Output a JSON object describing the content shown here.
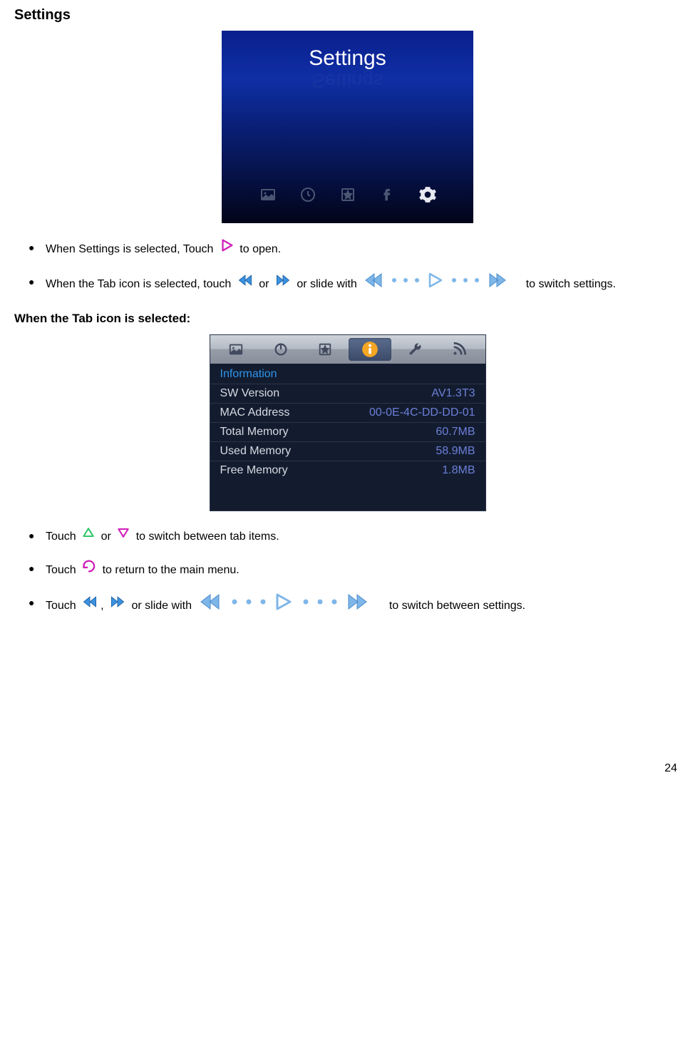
{
  "heading": "Settings",
  "settings_screen": {
    "title": "Settings",
    "icons": [
      {
        "name": "picture-icon",
        "active": false
      },
      {
        "name": "clock-icon",
        "active": false
      },
      {
        "name": "star-icon",
        "active": false
      },
      {
        "name": "facebook-icon",
        "active": false
      },
      {
        "name": "gear-icon",
        "active": true
      }
    ]
  },
  "bullets_top": [
    {
      "pre": "When Settings is selected, Touch ",
      "post": " to open."
    },
    {
      "pre": "When the Tab icon is selected, touch ",
      "mid1": " or ",
      "mid2": " or slide with  ",
      "post": "  to switch settings."
    }
  ],
  "subheading": "When the Tab icon is selected:",
  "info_screen": {
    "tabs": [
      {
        "name": "picture-icon",
        "active": false
      },
      {
        "name": "power-icon",
        "active": false
      },
      {
        "name": "star-icon",
        "active": false
      },
      {
        "name": "info-icon",
        "active": true
      },
      {
        "name": "wrench-icon",
        "active": false
      },
      {
        "name": "rss-icon",
        "active": false
      }
    ],
    "header": "Information",
    "rows": [
      {
        "label": "SW Version",
        "value": "AV1.3T3"
      },
      {
        "label": "MAC Address",
        "value": "00-0E-4C-DD-DD-01"
      },
      {
        "label": "Total Memory",
        "value": "60.7MB"
      },
      {
        "label": "Used Memory",
        "value": "58.9MB"
      },
      {
        "label": "Free Memory",
        "value": "1.8MB"
      }
    ]
  },
  "bullets_bottom": [
    {
      "pre": "Touch ",
      "mid": " or ",
      "post": " to switch between tab items."
    },
    {
      "pre": "Touch  ",
      "post": "  to return to the main menu."
    },
    {
      "pre": "Touch ",
      "sep": ", ",
      "mid": " or slide with  ",
      "post": " to switch between settings."
    }
  ],
  "page_number": "24"
}
